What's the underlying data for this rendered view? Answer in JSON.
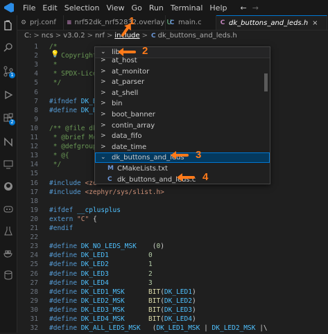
{
  "menu": [
    "File",
    "Edit",
    "Selection",
    "View",
    "Go",
    "Run",
    "Terminal",
    "Help"
  ],
  "nav_arrows": {
    "back": "←",
    "forward": "→"
  },
  "tabs": [
    {
      "icon": "⚙",
      "label": "prj.conf"
    },
    {
      "icon": "≡",
      "label": "nrf52dk_nrf52832.overlay",
      "modified": "U"
    },
    {
      "icon": "C",
      "label": "main.c"
    },
    {
      "icon": "C",
      "label": "dk_buttons_and_leds.h",
      "close": "×"
    }
  ],
  "breadcrumb": [
    "C:",
    "ncs",
    "v3.0.2",
    "nrf",
    "include",
    "dk_buttons_and_leds.h"
  ],
  "breadcrumb_sep": ">",
  "breadcrumb_file_icon": "C",
  "dropdown": {
    "items": [
      {
        "chev": "⌄",
        "label": "lib"
      },
      {
        "chev": ">",
        "label": "at_host"
      },
      {
        "chev": ">",
        "label": "at_monitor"
      },
      {
        "chev": ">",
        "label": "at_parser"
      },
      {
        "chev": ">",
        "label": "at_shell"
      },
      {
        "chev": ">",
        "label": "bin"
      },
      {
        "chev": ">",
        "label": "boot_banner"
      },
      {
        "chev": ">",
        "label": "contin_array"
      },
      {
        "chev": ">",
        "label": "data_fifo"
      },
      {
        "chev": ">",
        "label": "date_time"
      },
      {
        "chev": "⌄",
        "label": "dk_buttons_and_leds"
      },
      {
        "icon": "M",
        "label": "CMakeLists.txt"
      },
      {
        "icon": "C",
        "label": "dk_buttons_and_leds.c"
      }
    ]
  },
  "annotations": [
    "1",
    "2",
    "3",
    "4"
  ],
  "code": [
    {
      "n": "1",
      "parts": [
        [
          "cmt",
          "/*"
        ]
      ]
    },
    {
      "n": "2",
      "parts": [
        [
          "cmt",
          " * Copyright"
        ]
      ]
    },
    {
      "n": "3",
      "parts": [
        [
          "cmt",
          " *"
        ]
      ]
    },
    {
      "n": "4",
      "parts": [
        [
          "cmt",
          " * SPDX-Lice"
        ]
      ]
    },
    {
      "n": "5",
      "parts": [
        [
          "cmt",
          " */"
        ]
      ]
    },
    {
      "n": "6",
      "parts": []
    },
    {
      "n": "7",
      "parts": [
        [
          "pp",
          "#ifndef"
        ],
        [
          "mac",
          " DK_B"
        ]
      ]
    },
    {
      "n": "8",
      "parts": [
        [
          "pp",
          "#define"
        ],
        [
          "mac",
          " DK_B"
        ]
      ]
    },
    {
      "n": "9",
      "parts": []
    },
    {
      "n": "10",
      "parts": [
        [
          "cmt",
          "/** @file dk"
        ]
      ]
    },
    {
      "n": "11",
      "parts": [
        [
          "cmt",
          " * @brief Mc"
        ]
      ]
    },
    {
      "n": "12",
      "parts": [
        [
          "cmt",
          " * @defgroup"
        ]
      ]
    },
    {
      "n": "13",
      "parts": [
        [
          "cmt",
          " * @{"
        ]
      ]
    },
    {
      "n": "14",
      "parts": [
        [
          "cmt",
          " */"
        ]
      ]
    },
    {
      "n": "15",
      "parts": []
    },
    {
      "n": "16",
      "parts": [
        [
          "pp",
          "#include"
        ],
        [
          "str",
          " <ze"
        ]
      ]
    },
    {
      "n": "17",
      "parts": [
        [
          "pp",
          "#include"
        ],
        [
          "str",
          " <zephyr/sys/slist.h>"
        ]
      ]
    },
    {
      "n": "18",
      "parts": []
    },
    {
      "n": "19",
      "parts": [
        [
          "pp",
          "#ifdef"
        ],
        [
          "mac",
          " __cplusplus"
        ]
      ]
    },
    {
      "n": "20",
      "parts": [
        [
          "pp",
          "extern"
        ],
        [
          "str",
          " \"C\""
        ],
        [
          "txt",
          " {"
        ]
      ]
    },
    {
      "n": "21",
      "parts": [
        [
          "pp",
          "#endif"
        ]
      ]
    },
    {
      "n": "22",
      "parts": []
    },
    {
      "n": "23",
      "parts": [
        [
          "pp",
          "#define"
        ],
        [
          "mac",
          " DK_NO_LEDS_MSK"
        ],
        [
          "txt",
          "    ("
        ],
        [
          "num",
          "0"
        ],
        [
          "txt",
          ")"
        ]
      ]
    },
    {
      "n": "24",
      "parts": [
        [
          "pp",
          "#define"
        ],
        [
          "mac",
          " DK_LED1"
        ],
        [
          "txt",
          "          "
        ],
        [
          "num",
          "0"
        ]
      ]
    },
    {
      "n": "25",
      "parts": [
        [
          "pp",
          "#define"
        ],
        [
          "mac",
          " DK_LED2"
        ],
        [
          "txt",
          "          "
        ],
        [
          "num",
          "1"
        ]
      ]
    },
    {
      "n": "26",
      "parts": [
        [
          "pp",
          "#define"
        ],
        [
          "mac",
          " DK_LED3"
        ],
        [
          "txt",
          "          "
        ],
        [
          "num",
          "2"
        ]
      ]
    },
    {
      "n": "27",
      "parts": [
        [
          "pp",
          "#define"
        ],
        [
          "mac",
          " DK_LED4"
        ],
        [
          "txt",
          "          "
        ],
        [
          "num",
          "3"
        ]
      ]
    },
    {
      "n": "28",
      "parts": [
        [
          "pp",
          "#define"
        ],
        [
          "mac",
          " DK_LED1_MSK"
        ],
        [
          "txt",
          "      "
        ],
        [
          "fn",
          "BIT"
        ],
        [
          "txt",
          "("
        ],
        [
          "mac",
          "DK_LED1"
        ],
        [
          "txt",
          ")"
        ]
      ]
    },
    {
      "n": "29",
      "parts": [
        [
          "pp",
          "#define"
        ],
        [
          "mac",
          " DK_LED2_MSK"
        ],
        [
          "txt",
          "      "
        ],
        [
          "fn",
          "BIT"
        ],
        [
          "txt",
          "("
        ],
        [
          "mac",
          "DK_LED2"
        ],
        [
          "txt",
          ")"
        ]
      ]
    },
    {
      "n": "30",
      "parts": [
        [
          "pp",
          "#define"
        ],
        [
          "mac",
          " DK_LED3_MSK"
        ],
        [
          "txt",
          "      "
        ],
        [
          "fn",
          "BIT"
        ],
        [
          "txt",
          "("
        ],
        [
          "mac",
          "DK_LED3"
        ],
        [
          "txt",
          ")"
        ]
      ]
    },
    {
      "n": "31",
      "parts": [
        [
          "pp",
          "#define"
        ],
        [
          "mac",
          " DK_LED4_MSK"
        ],
        [
          "txt",
          "      "
        ],
        [
          "fn",
          "BIT"
        ],
        [
          "txt",
          "("
        ],
        [
          "mac",
          "DK_LED4"
        ],
        [
          "txt",
          ")"
        ]
      ]
    },
    {
      "n": "32",
      "parts": [
        [
          "pp",
          "#define"
        ],
        [
          "mac",
          " DK_ALL_LEDS_MSK"
        ],
        [
          "txt",
          "   ("
        ],
        [
          "mac",
          "DK_LED1_MSK"
        ],
        [
          "txt",
          " | "
        ],
        [
          "mac",
          "DK_LED2_MSK"
        ],
        [
          "txt",
          " |\\"
        ]
      ]
    }
  ]
}
